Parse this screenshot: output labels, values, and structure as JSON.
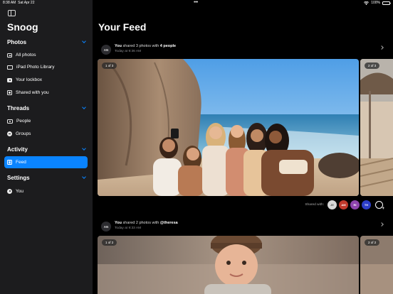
{
  "status_bar": {
    "time": "8:38 AM",
    "date": "Sat Apr 22",
    "dots": "•••",
    "battery": "100%",
    "battery_level": 1.0
  },
  "sidebar": {
    "toggle_icon": "sidebar-icon",
    "app_title": "Snoog",
    "sections": [
      {
        "label": "Photos",
        "items": [
          {
            "label": "All photos",
            "icon": "photo-icon"
          },
          {
            "label": "iPad Photo Library",
            "icon": "library-icon"
          },
          {
            "label": "Your lockbox",
            "icon": "lockbox-icon"
          },
          {
            "label": "Shared with you",
            "icon": "shared-icon"
          }
        ]
      },
      {
        "label": "Threads",
        "items": [
          {
            "label": "People",
            "icon": "people-icon"
          },
          {
            "label": "Groups",
            "icon": "groups-icon"
          }
        ]
      },
      {
        "label": "Activity",
        "items": [
          {
            "label": "Feed",
            "icon": "feed-icon",
            "active": true
          }
        ]
      },
      {
        "label": "Settings",
        "items": [
          {
            "label": "You",
            "icon": "person-icon"
          }
        ]
      }
    ],
    "accent_color": "#0a84ff"
  },
  "main": {
    "title": "Your Feed",
    "posts": [
      {
        "avatar": "AN",
        "text_you": "You",
        "text_mid": " shared 3 photos with ",
        "text_target": "4 people",
        "time": "Today at 9:36 AM",
        "badge_main": "1 of 3",
        "badge_next": "2 of 3",
        "shared_label": "Shared with:",
        "shared_with": [
          {
            "initials": "JE",
            "color": "#d8d8d8"
          },
          {
            "initials": "AM",
            "color": "#c0392b"
          },
          {
            "initials": "RI",
            "color": "#8e44ad"
          },
          {
            "initials": "TH",
            "color": "#2c3ec8"
          }
        ]
      },
      {
        "avatar": "AN",
        "text_you": "You",
        "text_mid": " shared 2 photos with ",
        "text_target": "@theresa",
        "time": "Today at 9:33 AM",
        "badge_main": "1 of 2",
        "badge_next": "2 of 2"
      }
    ]
  }
}
